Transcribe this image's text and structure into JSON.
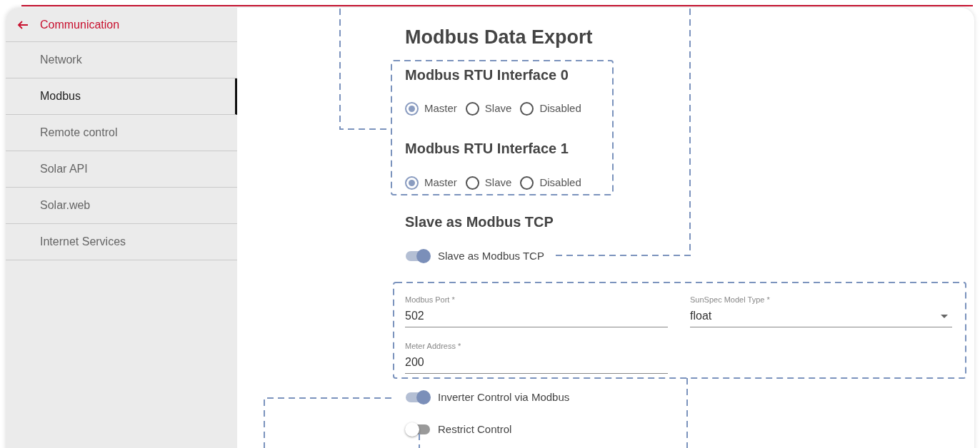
{
  "sidebar": {
    "back": {
      "label": "Communication"
    },
    "items": [
      {
        "label": "Network",
        "selected": false
      },
      {
        "label": "Modbus",
        "selected": true
      },
      {
        "label": "Remote control",
        "selected": false
      },
      {
        "label": "Solar API",
        "selected": false
      },
      {
        "label": "Solar.web",
        "selected": false
      },
      {
        "label": "Internet Services",
        "selected": false
      }
    ]
  },
  "title": "Modbus Data Export",
  "rtu_interfaces": [
    {
      "title": "Modbus RTU Interface 0",
      "options": [
        {
          "label": "Master",
          "selected": true
        },
        {
          "label": "Slave",
          "selected": false
        },
        {
          "label": "Disabled",
          "selected": false
        }
      ]
    },
    {
      "title": "Modbus RTU Interface 1",
      "options": [
        {
          "label": "Master",
          "selected": true
        },
        {
          "label": "Slave",
          "selected": false
        },
        {
          "label": "Disabled",
          "selected": false
        }
      ]
    }
  ],
  "tcp": {
    "title": "Slave as Modbus TCP",
    "toggle": {
      "label": "Slave as Modbus TCP",
      "on": true
    }
  },
  "fields": [
    {
      "label": "Modbus Port *",
      "value": "502",
      "kind": "text"
    },
    {
      "label": "SunSpec Model Type *",
      "value": "float",
      "kind": "select"
    },
    {
      "label": "Meter Address *",
      "value": "200",
      "kind": "text"
    }
  ],
  "toggles": [
    {
      "label": "Inverter Control via Modbus",
      "on": true
    },
    {
      "label": "Restrict Control",
      "on": false
    }
  ]
}
